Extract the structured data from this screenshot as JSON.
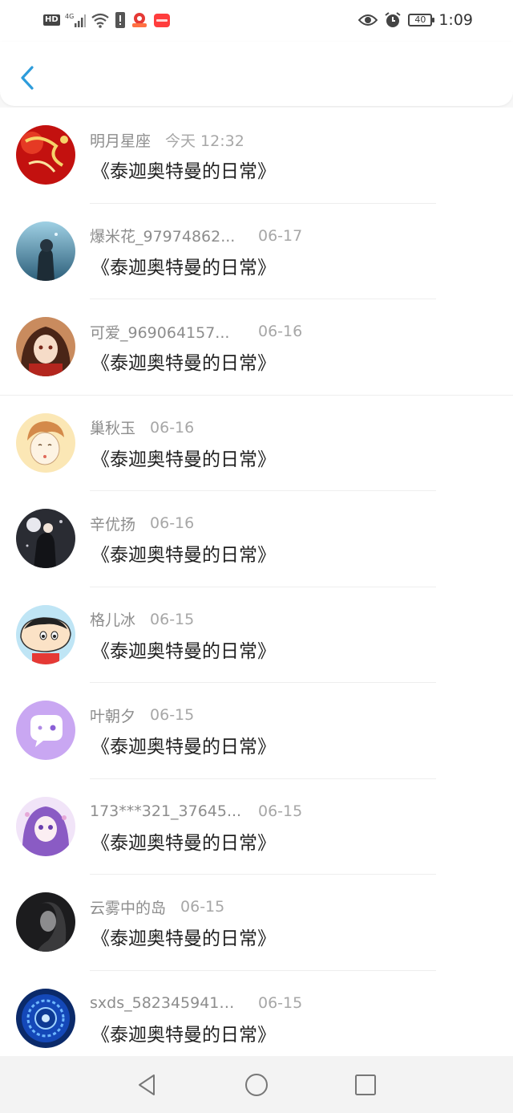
{
  "status_bar": {
    "left_icons": [
      "hd-icon",
      "4g-signal-icon",
      "wifi-icon",
      "alert-icon",
      "app-icon-red",
      "app-icon-shop"
    ],
    "hd_label": "HD",
    "network_label": "4G",
    "battery": "40",
    "time": "1:09"
  },
  "colors": {
    "accent": "#2d9cdb",
    "text_primary": "#222222",
    "text_secondary": "#9a9a9a"
  },
  "messages": [
    {
      "name": "明月星座",
      "time": "今天 12:32",
      "content": "《泰迦奥特曼的日常》",
      "avatar": "red-new-year-avatar"
    },
    {
      "name": "爆米花_97974862...",
      "time": "06-17",
      "content": "《泰迦奥特曼的日常》",
      "avatar": "blue-hand-avatar"
    },
    {
      "name": "可爱_969064157...",
      "time": "06-16",
      "content": "《泰迦奥特曼的日常》",
      "avatar": "anime-girl-avatar"
    },
    {
      "name": "巢秋玉",
      "time": "06-16",
      "content": "《泰迦奥特曼的日常》",
      "avatar": "cartoon-face-avatar"
    },
    {
      "name": "辛优扬",
      "time": "06-16",
      "content": "《泰迦奥特曼的日常》",
      "avatar": "dark-couple-avatar"
    },
    {
      "name": "格儿冰",
      "time": "06-15",
      "content": "《泰迦奥特曼的日常》",
      "avatar": "crayon-shin-avatar"
    },
    {
      "name": "叶朝夕",
      "time": "06-15",
      "content": "《泰迦奥特曼的日常》",
      "avatar": "purple-chat-avatar"
    },
    {
      "name": "173***321_37645...",
      "time": "06-15",
      "content": "《泰迦奥特曼的日常》",
      "avatar": "purple-anime-avatar"
    },
    {
      "name": "云雾中的岛",
      "time": "06-15",
      "content": "《泰迦奥特曼的日常》",
      "avatar": "dark-portrait-avatar"
    },
    {
      "name": "sxds_5823459413...",
      "time": "06-15",
      "content": "《泰迦奥特曼的日常》",
      "avatar": "blue-orb-avatar"
    }
  ],
  "nav": [
    "back-triangle-icon",
    "home-circle-icon",
    "recents-square-icon"
  ]
}
